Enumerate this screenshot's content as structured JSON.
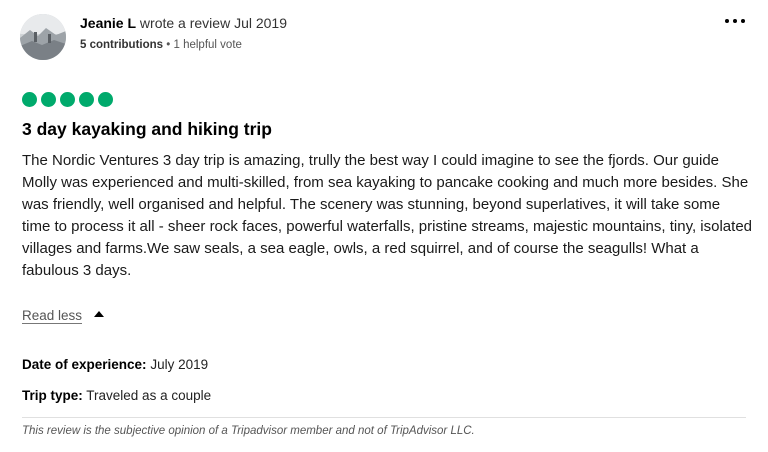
{
  "reviewer": {
    "name": "Jeanie L",
    "action": "wrote a review Jul 2019",
    "contributions": "5 contributions",
    "separator": "•",
    "helpful_votes": "1 helpful vote"
  },
  "rating": {
    "value": 5,
    "max": 5,
    "color": "#00aa6c"
  },
  "review": {
    "title": "3 day kayaking and hiking trip",
    "body": "The Nordic Ventures 3 day trip is amazing, trully the best way I could imagine to see the fjords. Our guide Molly was experienced and multi-skilled, from sea kayaking to pancake cooking and much more besides. She was friendly, well organised and helpful. The scenery was stunning, beyond superlatives, it will take some time to process it all - sheer rock faces, powerful waterfalls, pristine streams, majestic mountains, tiny, isolated villages and farms.We saw seals, a sea eagle, owls, a red squirrel, and of course the seagulls! What a fabulous 3 days.",
    "read_less": "Read less"
  },
  "details": {
    "date_label": "Date of experience:",
    "date_value": "July 2019",
    "trip_label": "Trip type:",
    "trip_value": "Traveled as a couple"
  },
  "disclaimer": "This review is the subjective opinion of a Tripadvisor member and not of TripAdvisor LLC."
}
